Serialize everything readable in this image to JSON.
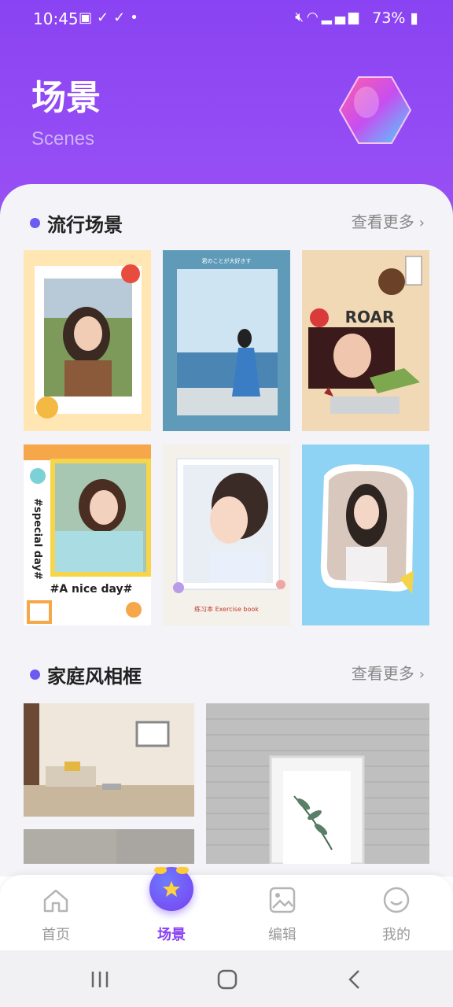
{
  "status_bar": {
    "time": "10:45",
    "left_icons": [
      "gallery-icon",
      "check-icon",
      "check-icon",
      "dot-icon"
    ],
    "battery": "73%"
  },
  "header": {
    "title": "场景",
    "subtitle": "Scenes"
  },
  "sections": [
    {
      "title": "流行场景",
      "more": "查看更多"
    },
    {
      "title": "家庭风相框",
      "more": "查看更多"
    }
  ],
  "popular_cards": [
    {
      "name": "polaroid-guitar-template",
      "caption": ""
    },
    {
      "name": "blue-seaside-template",
      "caption": "君のことが大好きす"
    },
    {
      "name": "roar-collage-template",
      "caption": "ROAR"
    },
    {
      "name": "special-day-template",
      "caption": "#A nice day#",
      "side_text": "#special day#"
    },
    {
      "name": "exercise-book-template",
      "caption": "练习本 Exercise book"
    },
    {
      "name": "blue-frame-template",
      "caption": ""
    }
  ],
  "home_cards": [
    {
      "name": "living-room-frame"
    },
    {
      "name": "brick-wall-frame"
    },
    {
      "name": "gray-room-frame"
    }
  ],
  "tabs": [
    {
      "label": "首页",
      "icon": "home-icon",
      "active": false
    },
    {
      "label": "场景",
      "icon": "star-icon",
      "active": true
    },
    {
      "label": "编辑",
      "icon": "image-edit-icon",
      "active": false
    },
    {
      "label": "我的",
      "icon": "smile-icon",
      "active": false
    }
  ],
  "colors": {
    "accent": "#8a43f2",
    "dot": "#6a5cf3",
    "sheet": "#f3f3f8"
  }
}
